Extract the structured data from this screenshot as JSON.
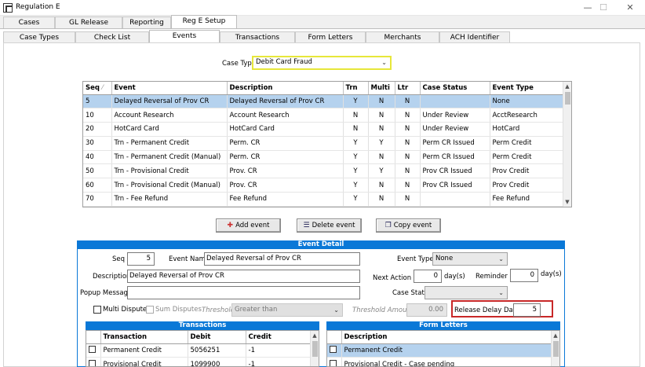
{
  "window": {
    "title": "Regulation E",
    "minimize": "—",
    "maximize": "☐",
    "close": "✕"
  },
  "main_tabs": [
    "Cases",
    "GL Release",
    "Reporting",
    "Reg E Setup"
  ],
  "sub_tabs": [
    "Case Types",
    "Check List",
    "Events",
    "Transactions",
    "Form Letters",
    "Merchants",
    "ACH Identifier"
  ],
  "case_type": {
    "label": "Case Type",
    "value": "Debit Card Fraud"
  },
  "events_grid": {
    "columns": [
      "Seq",
      "Event",
      "Description",
      "Trn",
      "Multi",
      "Ltr",
      "Case Status",
      "Event Type"
    ],
    "sort_indicator": "⁄",
    "rows": [
      [
        "5",
        "Delayed Reversal of Prov CR",
        "Delayed Reversal of Prov CR",
        "Y",
        "N",
        "N",
        "",
        "None"
      ],
      [
        "10",
        "Account Research",
        "Account Research",
        "N",
        "N",
        "N",
        "Under Review",
        "AcctResearch"
      ],
      [
        "20",
        "HotCard Card",
        "HotCard Card",
        "N",
        "N",
        "N",
        "Under Review",
        "HotCard"
      ],
      [
        "30",
        "Trn - Permanent Credit",
        "Perm. CR",
        "Y",
        "Y",
        "N",
        "Perm CR Issued",
        "Perm Credit"
      ],
      [
        "40",
        "Trn - Permanent Credit (Manual)",
        "Perm. CR",
        "Y",
        "N",
        "N",
        "Perm CR Issued",
        "Perm Credit"
      ],
      [
        "50",
        "Trn - Provisional Credit",
        "Prov. CR",
        "Y",
        "Y",
        "N",
        "Prov CR Issued",
        "Prov Credit"
      ],
      [
        "60",
        "Trn - Provisional Credit (Manual)",
        "Prov. CR",
        "Y",
        "N",
        "N",
        "Prov CR Issued",
        "Prov Credit"
      ],
      [
        "70",
        "Trn - Fee Refund",
        "Fee Refund",
        "Y",
        "N",
        "N",
        "",
        "Fee Refund"
      ]
    ]
  },
  "buttons": {
    "add": "Add event",
    "delete": "Delete event",
    "copy": "Copy event"
  },
  "event_detail": {
    "header": "Event Detail",
    "seq_label": "Seq",
    "seq_value": "5",
    "event_name_label": "Event Name",
    "event_name_value": "Delayed Reversal of Prov CR",
    "event_type_label": "Event Type",
    "event_type_value": "None",
    "description_label": "Description",
    "description_value": "Delayed Reversal of Prov CR",
    "next_action_label": "Next Action +",
    "next_action_value": "0",
    "days_label": "day(s)",
    "reminder_label": "Reminder +",
    "reminder_value": "0",
    "popup_label": "Popup Message",
    "popup_value": "",
    "case_state_label": "Case State",
    "case_state_value": "",
    "multi_dispute_label": "Multi Dispute",
    "sum_disputes_label": "Sum Disputes",
    "threshold_label": "Threshold",
    "threshold_value": "Greater than",
    "threshold_amount_label": "Threshold Amount",
    "threshold_amount_value": "0.00",
    "release_delay_label": "Release Delay Days",
    "release_delay_value": "5"
  },
  "transactions": {
    "header": "Transactions",
    "columns": [
      "Transaction",
      "Debit",
      "Credit"
    ],
    "rows": [
      [
        "Permanent Credit",
        "5056251",
        "-1"
      ],
      [
        "Provisional Credit",
        "1099900",
        "-1"
      ]
    ]
  },
  "form_letters": {
    "header": "Form Letters",
    "columns": [
      "Description"
    ],
    "rows": [
      "Permanent Credit",
      "Provisional Credit - Case pending"
    ]
  },
  "colors": {
    "accent": "#0a78d7",
    "selection": "#b5d2ee",
    "highlight_border": "#c82828",
    "case_type_border": "#e7e73a"
  }
}
